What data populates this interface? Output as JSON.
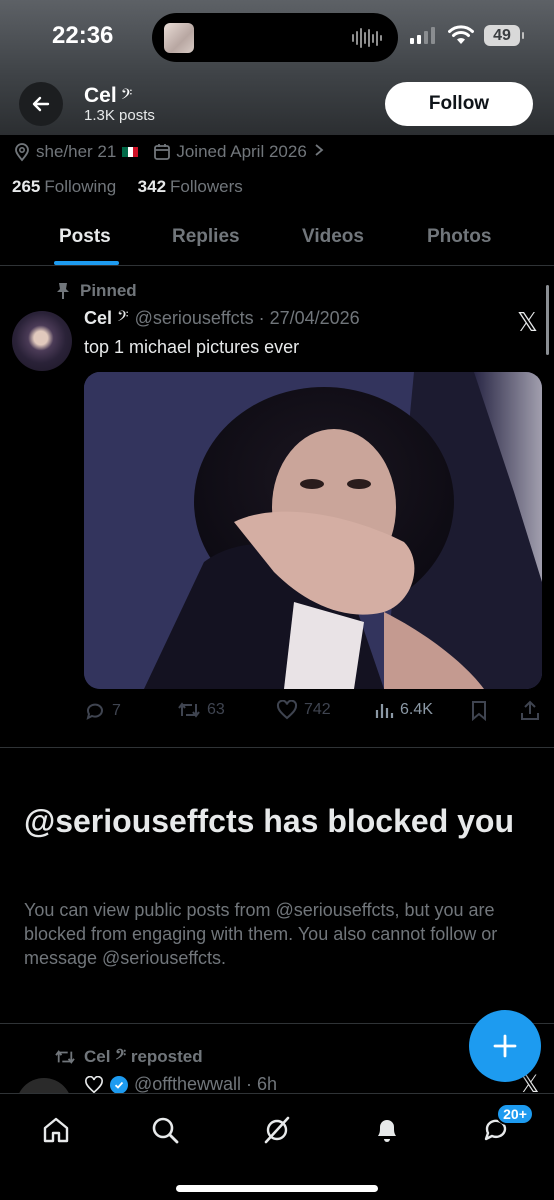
{
  "status_bar": {
    "time": "22:36",
    "battery": "49"
  },
  "header": {
    "name": "Cel",
    "name_emoji": "𝄢",
    "post_count": "1.3K posts",
    "follow_label": "Follow"
  },
  "profile": {
    "pronouns_age": "she/her 21",
    "joined": "Joined April 2026",
    "following_count": "265",
    "following_label": "Following",
    "followers_count": "342",
    "followers_label": "Followers"
  },
  "tabs": [
    {
      "label": "Posts",
      "active": true
    },
    {
      "label": "Replies",
      "active": false
    },
    {
      "label": "Videos",
      "active": false
    },
    {
      "label": "Photos",
      "active": false
    }
  ],
  "pinned_post": {
    "pinned_label": "Pinned",
    "author": "Cel",
    "author_emoji": "𝄢",
    "handle_date": "@seriouseffcts · 27/04/2026",
    "text": "top 1 michael pictures ever",
    "replies": "7",
    "reposts": "63",
    "likes": "742",
    "views": "6.4K"
  },
  "blocked": {
    "title": "@seriouseffcts has blocked you",
    "body": "You can view public posts from @seriouseffcts, but you are blocked from engaging with them. You also cannot follow or message @seriouseffcts."
  },
  "repost": {
    "label": "Cel 𝄢 reposted",
    "handle_time": "@offthewwall · 6h"
  },
  "bottom_nav": {
    "messages_badge": "20+"
  },
  "colors": {
    "accent": "#1d9bf0",
    "muted": "#71767b",
    "text": "#e7e9ea",
    "background": "#000000"
  }
}
